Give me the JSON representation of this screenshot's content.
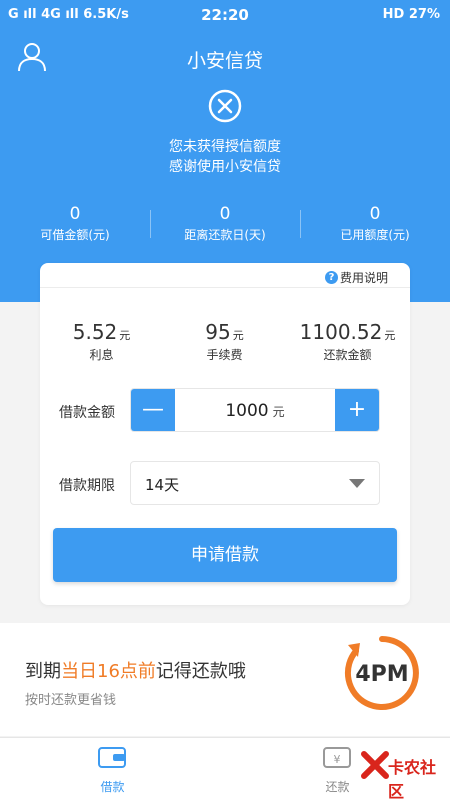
{
  "status_bar": {
    "left": "G  ıll 4G  ıll 6.5K/s",
    "time": "22:20",
    "right": "HD 27%"
  },
  "header": {
    "title": "小安信贷",
    "message_line1": "您未获得授信额度",
    "message_line2": "感谢使用小安信贷"
  },
  "stats": [
    {
      "value": "0",
      "label": "可借金额(元)"
    },
    {
      "value": "0",
      "label": "距离还款日(天)"
    },
    {
      "value": "0",
      "label": "已用额度(元)"
    }
  ],
  "card": {
    "fee_help": "费用说明",
    "fees": [
      {
        "value": "5.52",
        "unit": "元",
        "label": "利息"
      },
      {
        "value": "95",
        "unit": "元",
        "label": "手续费"
      },
      {
        "value": "1100.52",
        "unit": "元",
        "label": "还款金额"
      }
    ],
    "amount_label": "借款金额",
    "amount_value": "1000",
    "amount_unit": "元",
    "minus": "—",
    "plus": "+",
    "term_label": "借款期限",
    "term_value": "14天",
    "apply_button": "申请借款"
  },
  "banner": {
    "prefix": "到期",
    "highlight": "当日16点前",
    "suffix": "记得还款哦",
    "subtitle": "按时还款更省钱",
    "clock_text": "4PM",
    "accent_color": "#f07c27"
  },
  "tabs": [
    {
      "label": "借款",
      "active": true,
      "icon": "wallet-icon"
    },
    {
      "label": "还款",
      "active": false,
      "icon": "repay-icon"
    }
  ],
  "watermark": "卡农社区",
  "colors": {
    "primary": "#3d9bf1"
  }
}
